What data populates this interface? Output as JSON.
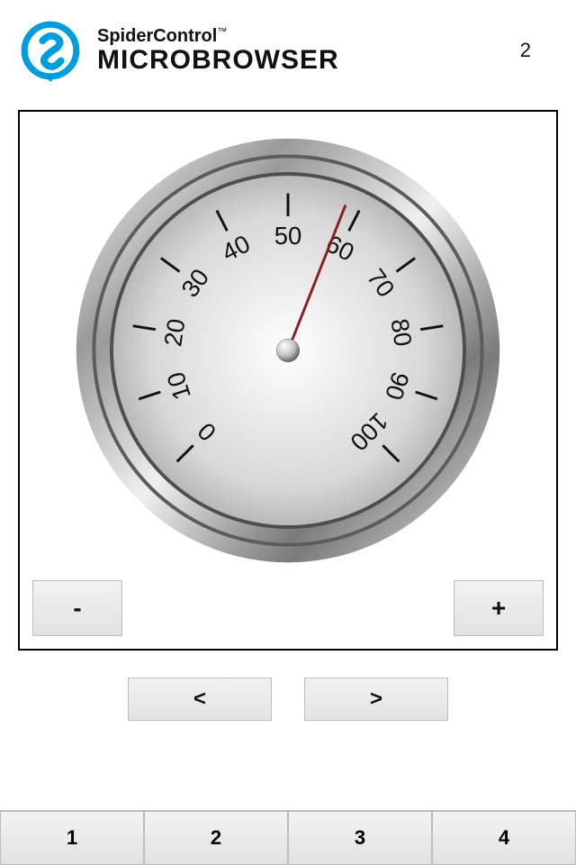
{
  "header": {
    "brand_top": "SpiderControl",
    "tm": "™",
    "brand_bottom": "MICROBROWSER",
    "page_number": "2"
  },
  "chart_data": {
    "type": "gauge",
    "min": 0,
    "max": 100,
    "value": 58,
    "ticks": [
      0,
      10,
      20,
      30,
      40,
      50,
      60,
      70,
      80,
      90,
      100
    ],
    "start_angle_deg": -225,
    "end_angle_deg": 45
  },
  "controls": {
    "minus": "-",
    "plus": "+",
    "prev": "<",
    "next": ">"
  },
  "tabs": [
    "1",
    "2",
    "3",
    "4"
  ]
}
